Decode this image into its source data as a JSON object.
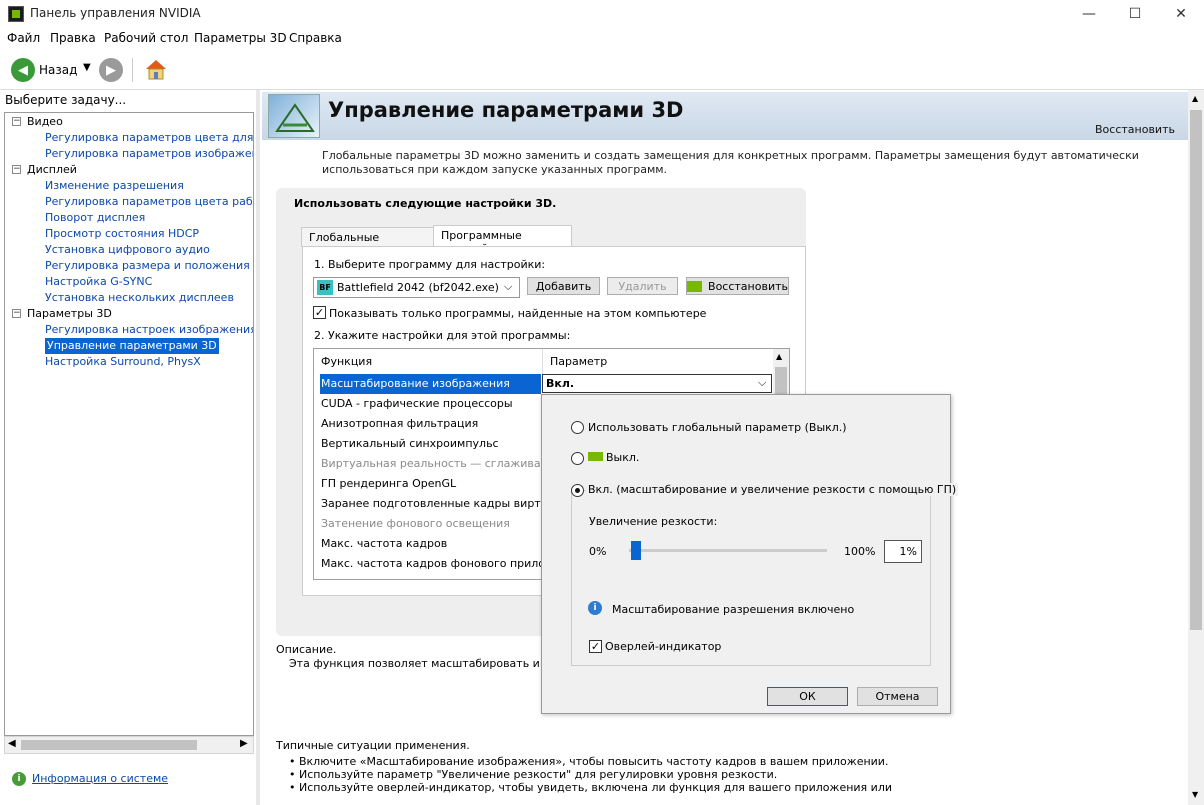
{
  "window": {
    "title": "Панель управления NVIDIA",
    "minimize": "—",
    "maximize": "☐",
    "close": "✕"
  },
  "menu": [
    "Файл",
    "Правка",
    "Рабочий стол",
    "Параметры 3D",
    "Справка"
  ],
  "toolbar": {
    "back_label": "Назад"
  },
  "sidebar": {
    "task_label": "Выберите задачу...",
    "tree": [
      {
        "label": "Видео",
        "level": 0
      },
      {
        "label": "Регулировка параметров цвета для видео",
        "level": 1
      },
      {
        "label": "Регулировка параметров изображения для видео",
        "level": 1
      },
      {
        "label": "Дисплей",
        "level": 0
      },
      {
        "label": "Изменение разрешения",
        "level": 1
      },
      {
        "label": "Регулировка параметров цвета рабочего стола",
        "level": 1
      },
      {
        "label": "Поворот дисплея",
        "level": 1
      },
      {
        "label": "Просмотр состояния HDCP",
        "level": 1
      },
      {
        "label": "Установка цифрового аудио",
        "level": 1
      },
      {
        "label": "Регулировка размера и положения рабочего стола",
        "level": 1
      },
      {
        "label": "Настройка G-SYNC",
        "level": 1
      },
      {
        "label": "Установка нескольких дисплеев",
        "level": 1
      },
      {
        "label": "Параметры 3D",
        "level": 0
      },
      {
        "label": "Регулировка настроек изображения с просмотром",
        "level": 1
      },
      {
        "label": "Управление параметрами 3D",
        "level": 1,
        "selected": true
      },
      {
        "label": "Настройка Surround, PhysX",
        "level": 1
      }
    ],
    "system_info": "Информация о системе"
  },
  "header": {
    "title": "Управление параметрами 3D",
    "restore": "Восстановить"
  },
  "intro": "Глобальные параметры 3D можно заменить и создать замещения для конкретных программ. Параметры замещения будут автоматически использоваться при каждом запуске указанных программ.",
  "settings": {
    "use_label": "Использовать следующие настройки 3D.",
    "tabs": [
      "Глобальные параметры",
      "Программные настройки"
    ],
    "step1": "1. Выберите программу для настройки:",
    "program": "Battlefield 2042 (bf2042.exe)",
    "program_icon": "BF",
    "add": "Добавить",
    "remove": "Удалить",
    "restore": "Восстановить",
    "show_only": "Показывать только программы, найденные на этом компьютере",
    "step2": "2. Укажите настройки для этой программы:",
    "col_function": "Функция",
    "col_param": "Параметр",
    "rows": [
      {
        "label": "Масштабирование изображения",
        "selected": true,
        "dim": false
      },
      {
        "label": "CUDA - графические процессоры",
        "dim": false
      },
      {
        "label": "Анизотропная фильтрация",
        "dim": false
      },
      {
        "label": "Вертикальный синхроимпульс",
        "dim": false
      },
      {
        "label": "Виртуальная реальность — сглаживан...",
        "dim": true
      },
      {
        "label": "ГП рендеринга OpenGL",
        "dim": false
      },
      {
        "label": "Заранее подготовленные кадры вирту...",
        "dim": false
      },
      {
        "label": "Затенение фонового освещения",
        "dim": true
      },
      {
        "label": "Макс. частота кадров",
        "dim": false
      },
      {
        "label": "Макс. частота кадров фонового прило...",
        "dim": false
      }
    ],
    "selected_value": "Вкл."
  },
  "popup": {
    "opt_global": "Использовать глобальный параметр (Выкл.)",
    "opt_off": "Выкл.",
    "opt_on": "Вкл. (масштабирование и увеличение резкости с помощью ГП)",
    "sharpen_label": "Увеличение резкости:",
    "min": "0%",
    "max": "100%",
    "value": "1%",
    "sharpen_fraction": 0.01,
    "info": "Масштабирование разрешения включено",
    "overlay": "Оверлей-индикатор",
    "ok": "ОК",
    "cancel": "Отмена"
  },
  "description": {
    "label": "Описание.",
    "text": "Эта функция позволяет масштабировать и повыш"
  },
  "usage": {
    "label": "Типичные ситуации применения.",
    "items": [
      "• Включите «Масштабирование изображения», чтобы повысить частоту кадров в вашем приложении.",
      "• Используйте параметр \"Увеличение резкости\" для регулировки уровня резкости.",
      "• Используйте оверлей-индикатор, чтобы увидеть, включена ли функция для вашего приложения или"
    ]
  },
  "colors": {
    "accent": "#0a64d2",
    "nvidia_green": "#76b900",
    "link": "#0b48a9"
  }
}
